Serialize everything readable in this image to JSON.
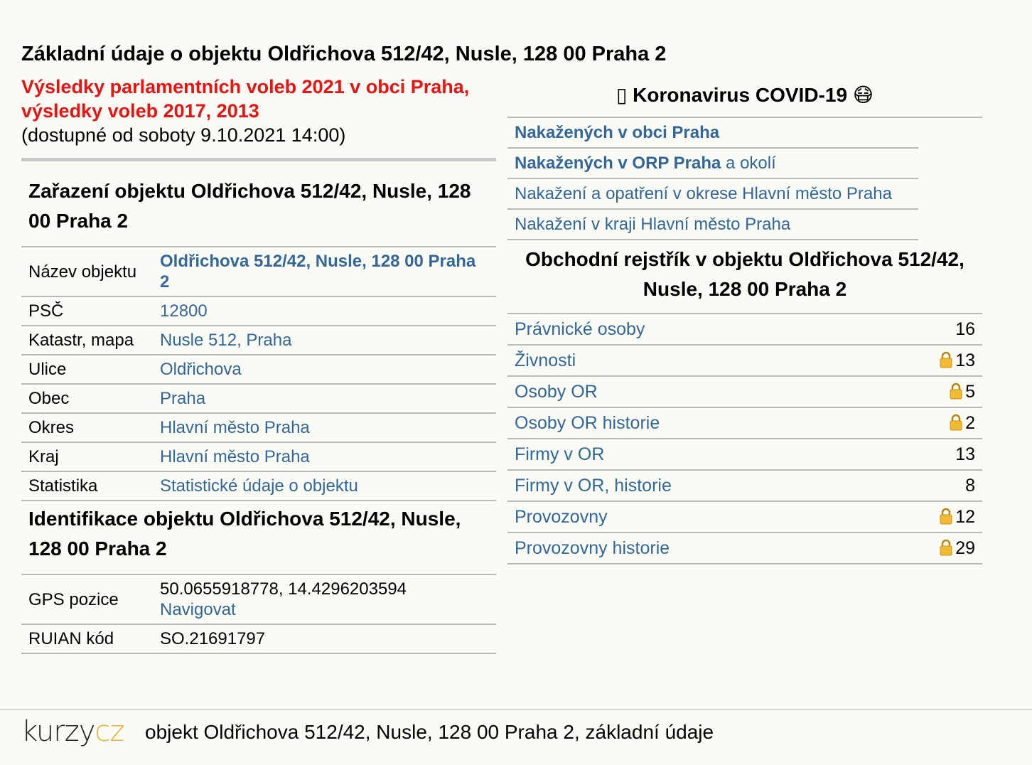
{
  "header": {
    "title": "Základní údaje o objektu Oldřichova 512/42, Nusle, 128 00 Praha 2",
    "election_link": "Výsledky parlamentních voleb 2021 v obci Praha, výsledky voleb 2017, 2013",
    "election_note": "(dostupné od soboty 9.10.2021 14:00)"
  },
  "zarazeni": {
    "title": "Zařazení objektu Oldřichova 512/42, Nusle, 128 00 Praha 2",
    "rows": [
      {
        "label": "Název objektu",
        "value": "Oldřichova 512/42, Nusle, 128 00 Praha 2"
      },
      {
        "label": "PSČ",
        "value": "12800"
      },
      {
        "label": "Katastr, mapa",
        "value": "Nusle 512, Praha"
      },
      {
        "label": "Ulice",
        "value": "Oldřichova"
      },
      {
        "label": "Obec",
        "value": "Praha"
      },
      {
        "label": "Okres",
        "value": "Hlavní město Praha"
      },
      {
        "label": "Kraj",
        "value": "Hlavní město Praha"
      },
      {
        "label": "Statistika",
        "value": "Statistické údaje o objektu"
      }
    ]
  },
  "identifikace": {
    "title": "Identifikace objektu Oldřichova 512/42, Nusle, 128 00 Praha 2",
    "gps_label": "GPS pozice",
    "gps_value": "50.0655918778, 14.4296203594",
    "gps_nav": "Navigovat",
    "ruian_label": "RUIAN kód",
    "ruian_value": "SO.21691797"
  },
  "covid": {
    "title": "Koronavirus COVID-19",
    "title_prefix": "▯",
    "title_emoji": "😷",
    "items": [
      {
        "text": "Nakažených v obci Praha"
      },
      {
        "text": "Nakažených v ORP Praha",
        "suffix": "a okolí"
      },
      {
        "text": "Nakažení a opatření v okrese Hlavní město Praha"
      },
      {
        "text": "Nakažení v kraji Hlavní město Praha"
      }
    ]
  },
  "rejstrik": {
    "title": "Obchodní rejstřík v objektu Oldřichova 512/42, Nusle, 128 00 Praha 2",
    "rows": [
      {
        "label": "Právnické osoby",
        "count": "16",
        "locked": false
      },
      {
        "label": "Živnosti",
        "count": "13",
        "locked": true
      },
      {
        "label": "Osoby OR",
        "count": "5",
        "locked": true
      },
      {
        "label": "Osoby OR historie",
        "count": "2",
        "locked": true
      },
      {
        "label": "Firmy v OR",
        "count": "13",
        "locked": false
      },
      {
        "label": "Firmy v OR, historie",
        "count": "8",
        "locked": false
      },
      {
        "label": "Provozovny",
        "count": "12",
        "locked": true
      },
      {
        "label": "Provozovny historie",
        "count": "29",
        "locked": true
      }
    ]
  },
  "footer": {
    "logo_part1": "kurzy",
    "logo_part2": "cz",
    "text": "objekt Oldřichova 512/42, Nusle, 128 00 Praha 2, základní údaje"
  },
  "colors": {
    "link": "#336699",
    "election_red": "#ee1111",
    "logo_accent": "#e8b53a",
    "background": "#fbfbf6"
  }
}
